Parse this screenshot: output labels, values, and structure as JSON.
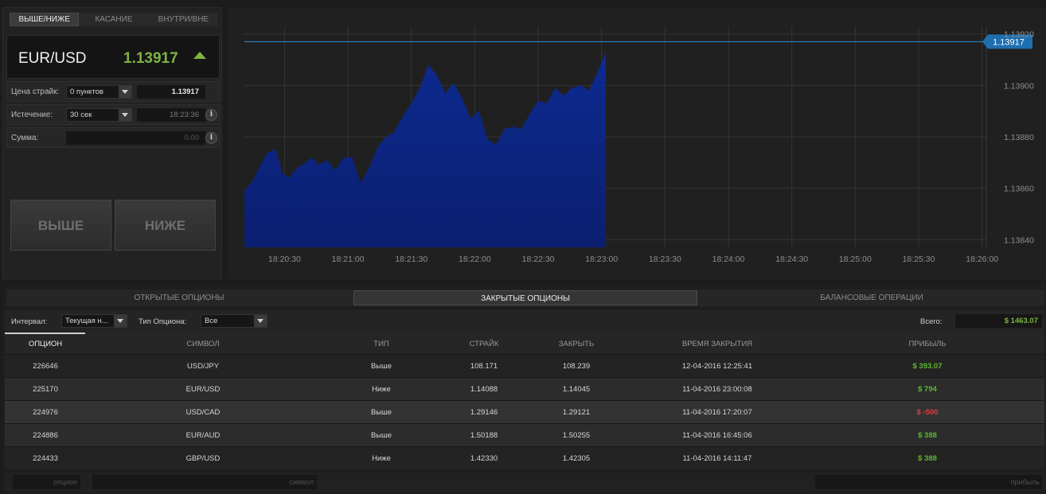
{
  "mode_tabs": [
    "ВЫШЕ/НИЖЕ",
    "КАСАНИЕ",
    "ВНУТРИ/ВНЕ"
  ],
  "asset": {
    "name": "EUR/USD",
    "price": "1.13917",
    "direction": "up",
    "price_color": "#7cb342"
  },
  "form": {
    "strike": {
      "label": "Цена страйк:",
      "select": "0 пунктов",
      "value": "1.13917"
    },
    "expiry": {
      "label": "Истечение:",
      "select": "30 сек",
      "value": "18:23:36"
    },
    "amount": {
      "label": "Сумма:",
      "value": "0.00"
    },
    "info_icon": "i"
  },
  "buttons": {
    "higher": "ВЫШЕ",
    "lower": "НИЖЕ"
  },
  "chart_data": {
    "type": "area",
    "series": [
      {
        "color": "#0d2a8f",
        "x": [
          "18:20:11",
          "18:20:15",
          "18:20:18",
          "18:20:22",
          "18:20:26",
          "18:20:29",
          "18:20:32",
          "18:20:36",
          "18:20:40",
          "18:20:43",
          "18:20:46",
          "18:20:50",
          "18:20:54",
          "18:20:58",
          "18:21:02",
          "18:21:06",
          "18:21:10",
          "18:21:14",
          "18:21:18",
          "18:21:22",
          "18:21:26",
          "18:21:30",
          "18:21:34",
          "18:21:38",
          "18:21:42",
          "18:21:46",
          "18:21:50",
          "18:21:54",
          "18:21:58",
          "18:22:02",
          "18:22:06",
          "18:22:10",
          "18:22:14",
          "18:22:18",
          "18:22:22",
          "18:22:26",
          "18:22:30",
          "18:22:34",
          "18:22:38",
          "18:22:42",
          "18:22:46",
          "18:22:50",
          "18:22:54",
          "18:22:58",
          "18:23:02"
        ],
        "values": [
          1.13859,
          1.13863,
          1.13868,
          1.13874,
          1.13875,
          1.13866,
          1.13864,
          1.13868,
          1.1387,
          1.13872,
          1.13869,
          1.13871,
          1.13867,
          1.13872,
          1.13872,
          1.13862,
          1.13868,
          1.13876,
          1.1388,
          1.13882,
          1.13888,
          1.13893,
          1.13899,
          1.13908,
          1.13904,
          1.13897,
          1.13901,
          1.13895,
          1.13887,
          1.1389,
          1.13879,
          1.13877,
          1.13883,
          1.13884,
          1.13883,
          1.13889,
          1.13894,
          1.13893,
          1.13899,
          1.13896,
          1.13899,
          1.139,
          1.13898,
          1.13905,
          1.13913
        ]
      }
    ],
    "current_price": 1.13917,
    "current_label": "1.13917",
    "y_ticks": [
      "1.13920",
      "1.13900",
      "1.13880",
      "1.13860",
      "1.13840"
    ],
    "ylim": [
      1.13837,
      1.13923
    ],
    "x_ticks": [
      "18:20:30",
      "18:21:00",
      "18:21:30",
      "18:22:00",
      "18:22:30",
      "18:23:00",
      "18:23:30",
      "18:24:00",
      "18:24:30",
      "18:25:00",
      "18:25:30",
      "18:26:00"
    ],
    "xlim": [
      "18:20:11",
      "18:26:02"
    ],
    "grid": true
  },
  "main_tabs": [
    "ОТКРЫТЫЕ ОПЦИОНЫ",
    "ЗАКРЫТЫЕ ОПЦИОНЫ",
    "БАЛАНСОВЫЕ ОПЕРАЦИИ"
  ],
  "filters": {
    "interval_label": "Интервал:",
    "interval_value": "Текущая н...",
    "type_label": "Тип Опциона:",
    "type_value": "Все",
    "total_label": "Всего:",
    "total_value": "$ 1463.07"
  },
  "table": {
    "headers": [
      "ОПЦИОН",
      "СИМВОЛ",
      "ТИП",
      "СТРАЙК",
      "ЗАКРЫТЬ",
      "ВРЕМЯ ЗАКРЫТИЯ",
      "ПРИБЫЛЬ"
    ],
    "rows": [
      [
        "226646",
        "USD/JPY",
        "Выше",
        "108.171",
        "108.239",
        "12-04-2016 12:25:41",
        "$ 393.07"
      ],
      [
        "225170",
        "EUR/USD",
        "Ниже",
        "1.14088",
        "1.14045",
        "11-04-2016 23:00:08",
        "$ 794"
      ],
      [
        "224976",
        "USD/CAD",
        "Выше",
        "1.29146",
        "1.29121",
        "11-04-2016 17:20:07",
        "$ -500"
      ],
      [
        "224886",
        "EUR/AUD",
        "Выше",
        "1.50188",
        "1.50255",
        "11-04-2016 16:45:06",
        "$ 388"
      ],
      [
        "224433",
        "GBP/USD",
        "Ниже",
        "1.42330",
        "1.42305",
        "11-04-2016 14:11:47",
        "$ 388"
      ]
    ],
    "profit_colors": {
      "positive": "#5cb82e",
      "negative": "#d84040"
    }
  },
  "footer_filters": {
    "option": "опцион",
    "symbol": "символ",
    "profit": "прибыль"
  }
}
